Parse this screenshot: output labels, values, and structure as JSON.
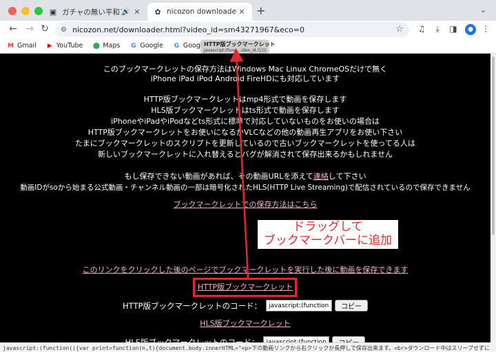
{
  "tabs": [
    {
      "title": "ガチャの無い平和アクション",
      "audio_icon": "speaker-icon"
    },
    {
      "title": "nicozon downloader"
    }
  ],
  "toolbar": {
    "url": "nicozon.net/downloader.html?video_id=sm43271967&eco=0"
  },
  "bookmarks": [
    {
      "label": "Gmail",
      "icon": "gmail-icon",
      "color": "#ea4335"
    },
    {
      "label": "YouTube",
      "icon": "youtube-icon",
      "color": "#ff0000"
    },
    {
      "label": "Maps",
      "icon": "maps-icon",
      "color": "#34a853"
    },
    {
      "label": "Google",
      "icon": "google-icon",
      "color": "#4285f4"
    },
    {
      "label": "Google japan",
      "icon": "google-icon",
      "color": "#4285f4"
    }
  ],
  "dragged_bookmark": {
    "title": "HTTP版ブックマークレット",
    "url": "javascript:(func....ideo_id.)})))()"
  },
  "content": {
    "intro1": "このブックマークレットの保存方法はWindows Mac Linux ChromeOSだけで無く",
    "intro2": "iPhone iPad iPod Android FireHDにも対応しています",
    "p1": "HTTP版ブックマークレットはmp4形式で動画を保存します",
    "p2": "HLS版ブックマークレットはts形式で動画を保存します",
    "p3": "iPhoneやiPadやiPodなどts形式に標準で対応していないものをお使いの場合は",
    "p4": "HTTP版ブックマークレットをお使いになるかVLCなどの他の動画再生アプリをお使い下さい",
    "p5": "たまにブックマークレットのスクリプトを更新しているので古いブックマークレットを使ってる人は",
    "p6": "新しいブックマークレットに入れ替えるとバグが解消されて保存出来るかもしれません",
    "contact_pre": "もし保存できない動画があれば、その動画URLを添えて",
    "contact_link": "連絡",
    "contact_post": "して下さい",
    "notice": "動画IDがsoから始まる公式動画・チャンネル動画の一部は暗号化されたHLS(HTTP Live Streaming)で配信されているので保存できません",
    "howto_link": "ブックマークレットでの保存方法はこちら",
    "click_link": "このリンクをクリックした後のページでブックマークレットを実行した後に動画を保存できます",
    "http_link": "HTTP版ブックマークレット",
    "http_code_label": "HTTP版ブックマークレットのコード：",
    "http_code_value": "javascript:(function(){va",
    "copy_label": "コピー",
    "hls_link": "HLS版ブックマークレット",
    "hls_code_label": "HLS版ブックマークレットのコード：",
    "hls_code_value": "javascript:(function(){va",
    "copy_label2": "コピー"
  },
  "annotation": {
    "line1": "ドラッグして",
    "line2": "ブックマークバーに追加",
    "color": "#e8262b"
  },
  "status_text": "javascript:(function(){var print=function(n,t){document.body.innerHTML=\"<p>下の動画リンクから右クリックか長押しで保存出来ます。<br>ダウンロード中はスリープせずにこのページを前面に開..."
}
